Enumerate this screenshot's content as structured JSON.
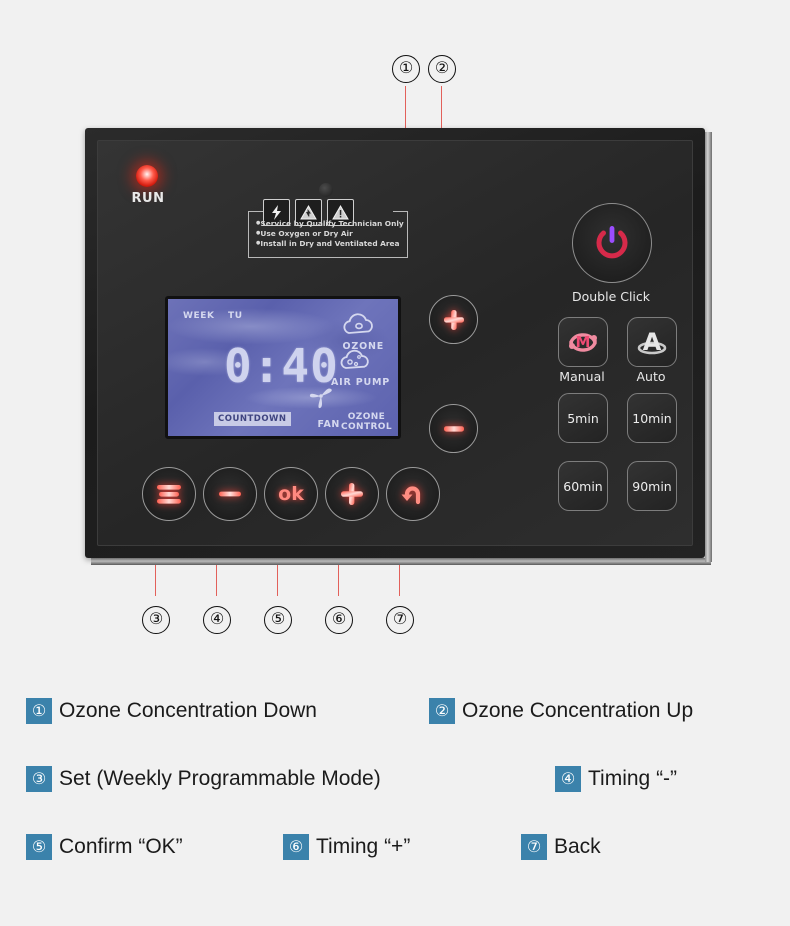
{
  "background_color": "#f1f1f1",
  "device": {
    "run_indicator": {
      "label": "RUN",
      "color": "#e22818"
    },
    "warning_label": {
      "icons": [
        "lightning-bolt-icon",
        "electric-shock-triangle-icon",
        "warning-triangle-icon"
      ],
      "lines": [
        "Service by Qualify Technician Only",
        "Use Oxygen or Dry Air",
        "Install in Dry and Ventilated Area"
      ]
    },
    "lcd": {
      "week_label": "WEEK",
      "day": "TU",
      "time": "0:40",
      "ozone_label": "OZONE",
      "air_pump_label": "AIR PUMP",
      "fan_label": "FAN",
      "ozone_control_label": "OZONE\nCONTROL",
      "ozone_control_line1": "OZONE",
      "ozone_control_line2": "CONTROL",
      "countdown_badge": "COUNTDOWN",
      "backlight_color": "#5f65b0"
    },
    "concentration_buttons": [
      {
        "name": "ozone-up-button",
        "glyph": "+"
      },
      {
        "name": "ozone-down-button",
        "glyph": "−"
      }
    ],
    "bottom_buttons": [
      {
        "name": "menu-set-button",
        "glyph": "menu-icon"
      },
      {
        "name": "timing-minus-button",
        "glyph": "−"
      },
      {
        "name": "confirm-ok-button",
        "glyph": "ok"
      },
      {
        "name": "timing-plus-button",
        "glyph": "+"
      },
      {
        "name": "back-button",
        "glyph": "back-arrow-icon"
      }
    ],
    "ok_button_text": "ok",
    "right_panel": {
      "power_caption": "Double Click",
      "mode_buttons": [
        {
          "label": "Manual",
          "glyph": "M",
          "color": "#ef5a7a"
        },
        {
          "label": "Auto",
          "glyph": "A",
          "color": "#d8d8d8"
        }
      ],
      "timer_buttons": [
        "5min",
        "10min",
        "60min",
        "90min"
      ]
    }
  },
  "callouts": {
    "top": [
      "①",
      "②"
    ],
    "bottom": [
      "③",
      "④",
      "⑤",
      "⑥",
      "⑦"
    ],
    "leader_color": "#e2605a"
  },
  "legend": {
    "badge_color": "#3b82ab",
    "items": [
      {
        "badge": "①",
        "text": "Ozone Concentration Down"
      },
      {
        "badge": "②",
        "text": "Ozone Concentration Up"
      },
      {
        "badge": "③",
        "text": "Set (Weekly Programmable Mode)"
      },
      {
        "badge": "④",
        "text": "Timing “-”"
      },
      {
        "badge": "⑤",
        "text": "Confirm “OK”"
      },
      {
        "badge": "⑥",
        "text": "Timing “+”"
      },
      {
        "badge": "⑦",
        "text": "Back"
      }
    ]
  }
}
